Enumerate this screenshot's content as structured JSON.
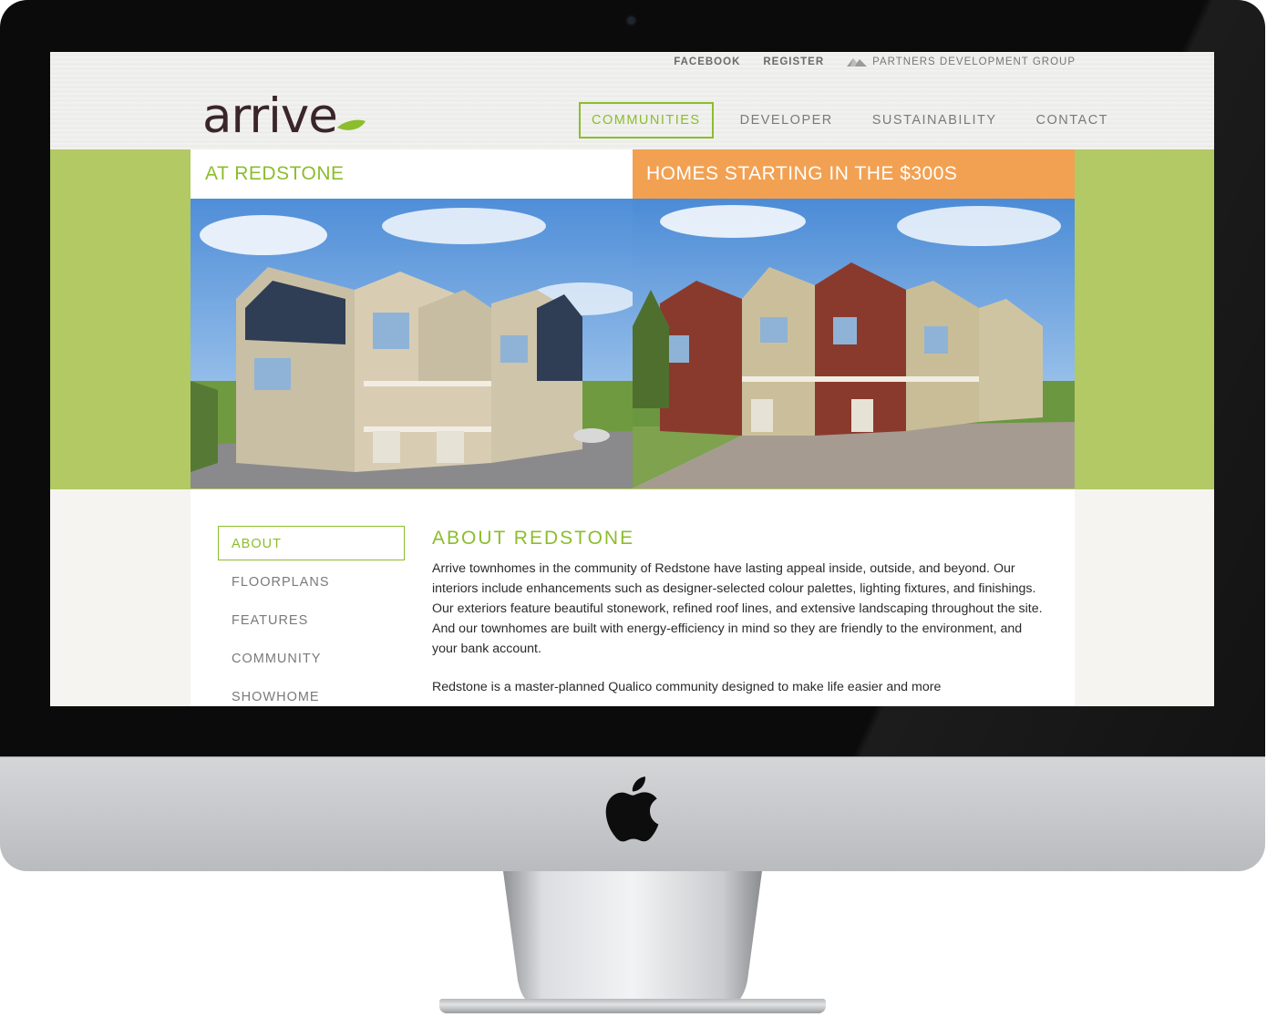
{
  "utility_nav": {
    "facebook": "FACEBOOK",
    "register": "REGISTER",
    "partner": "PARTNERS DEVELOPMENT GROUP"
  },
  "brand": {
    "logo_text": "arrive",
    "accent_color": "#8cbd2c",
    "orange": "#f2a152",
    "green_band": "#b2c964"
  },
  "main_nav": [
    {
      "label": "COMMUNITIES",
      "active": true
    },
    {
      "label": "DEVELOPER",
      "active": false
    },
    {
      "label": "SUSTAINABILITY",
      "active": false
    },
    {
      "label": "CONTACT",
      "active": false
    }
  ],
  "hero": {
    "left_heading": "AT REDSTONE",
    "right_heading": "HOMES STARTING IN THE $300S"
  },
  "sub_nav": [
    {
      "label": "ABOUT",
      "active": true
    },
    {
      "label": "FLOORPLANS",
      "active": false
    },
    {
      "label": "FEATURES",
      "active": false
    },
    {
      "label": "COMMUNITY",
      "active": false
    },
    {
      "label": "SHOWHOME",
      "active": false
    }
  ],
  "article": {
    "title": "ABOUT REDSTONE",
    "paragraphs": [
      "Arrive townhomes in the community of Redstone have lasting appeal inside, outside, and beyond. Our interiors include enhancements such as designer-selected colour palettes, lighting fixtures, and finishings. Our exteriors feature beautiful stonework, refined roof lines, and extensive landscaping throughout the site. And our townhomes are built with energy-efficiency in mind so they are friendly to the environment, and your bank account.",
      "Redstone is a master-planned Qualico community designed to make life easier and more"
    ]
  }
}
